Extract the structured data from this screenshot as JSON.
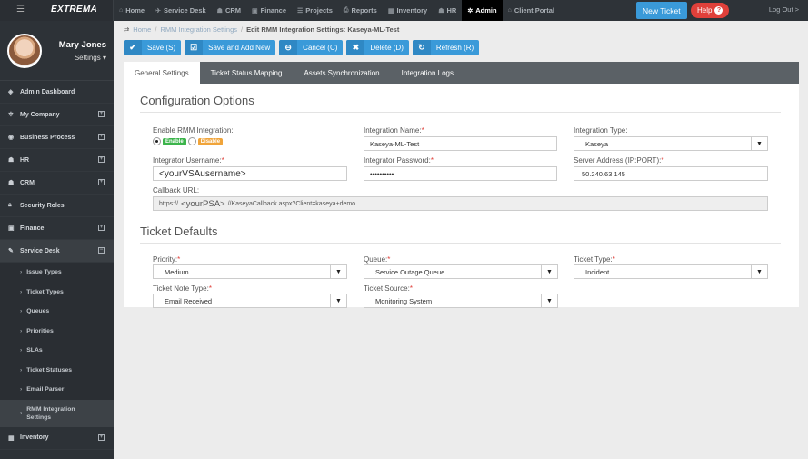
{
  "brand": "EXTREMA",
  "topnav": [
    {
      "icon": "home-icon",
      "glyph": "⌂",
      "label": "Home"
    },
    {
      "icon": "service-desk-icon",
      "glyph": "✈",
      "label": "Service Desk"
    },
    {
      "icon": "crm-icon",
      "glyph": "☗",
      "label": "CRM"
    },
    {
      "icon": "finance-icon",
      "glyph": "▣",
      "label": "Finance"
    },
    {
      "icon": "projects-icon",
      "glyph": "☰",
      "label": "Projects"
    },
    {
      "icon": "reports-icon",
      "glyph": "⎙",
      "label": "Reports"
    },
    {
      "icon": "inventory-icon",
      "glyph": "▦",
      "label": "Inventory"
    },
    {
      "icon": "hr-icon",
      "glyph": "☗",
      "label": "HR"
    },
    {
      "icon": "admin-icon",
      "glyph": "✲",
      "label": "Admin",
      "active": true
    },
    {
      "icon": "client-portal-icon",
      "glyph": "⌂",
      "label": "Client Portal"
    }
  ],
  "new_ticket_label": "New Ticket",
  "help_label": "Help",
  "logout_label": "Log Out >",
  "profile": {
    "name": "Mary Jones",
    "settings_label": "Settings ▾"
  },
  "sidebar": {
    "admin_dashboard": "Admin Dashboard",
    "my_company": "My Company",
    "business_process": "Business Process",
    "hr": "HR",
    "crm": "CRM",
    "security_roles": "Security Roles",
    "finance": "Finance",
    "service_desk": "Service Desk",
    "subs": [
      "Issue Types",
      "Ticket Types",
      "Queues",
      "Priorities",
      "SLAs",
      "Ticket Statuses",
      "Email Parser"
    ],
    "rmm_line1": "RMM Integration",
    "rmm_line2": "Settings",
    "inventory": "Inventory"
  },
  "breadcrumb": {
    "home": "Home",
    "rmm": "RMM Integration Settings",
    "current": "Edit RMM Integration Settings: Kaseya-ML-Test"
  },
  "toolbar": {
    "save": "Save (S)",
    "save_add": "Save and Add New",
    "cancel": "Cancel (C)",
    "delete": "Delete (D)",
    "refresh": "Refresh (R)"
  },
  "tabs": [
    "General Settings",
    "Ticket Status Mapping",
    "Assets Synchronization",
    "Integration Logs"
  ],
  "config": {
    "title": "Configuration Options",
    "enable_label": "Enable RMM Integration:",
    "enable": "Enable",
    "disable": "Disable",
    "name_label": "Integration Name:",
    "name_value": "Kaseya-ML-Test",
    "type_label": "Integration Type:",
    "type_value": "Kaseya",
    "username_label": "Integrator Username:",
    "username_value": "<yourVSAusername>",
    "password_label": "Integrator Password:",
    "password_value": "••••••••••",
    "server_label": "Server Address (IP:PORT):",
    "server_value": "50.240.63.145",
    "callback_label": "Callback URL:",
    "callback_prefix": "https://",
    "callback_psa": "<yourPSA>",
    "callback_suffix": "//KaseyaCallback.aspx?Client=kaseya+demo"
  },
  "defaults": {
    "title": "Ticket Defaults",
    "priority_label": "Priority:",
    "priority_value": "Medium",
    "queue_label": "Queue:",
    "queue_value": "Service Outage Queue",
    "type_label": "Ticket Type:",
    "type_value": "Incident",
    "note_label": "Ticket Note Type:",
    "note_value": "Email Received",
    "source_label": "Ticket Source:",
    "source_value": "Monitoring System"
  },
  "required_mark": "*",
  "colors": {
    "accent": "#3a9ad9",
    "danger": "#e0403a",
    "sidebar": "#2d3237",
    "topbar": "#2e3338"
  }
}
